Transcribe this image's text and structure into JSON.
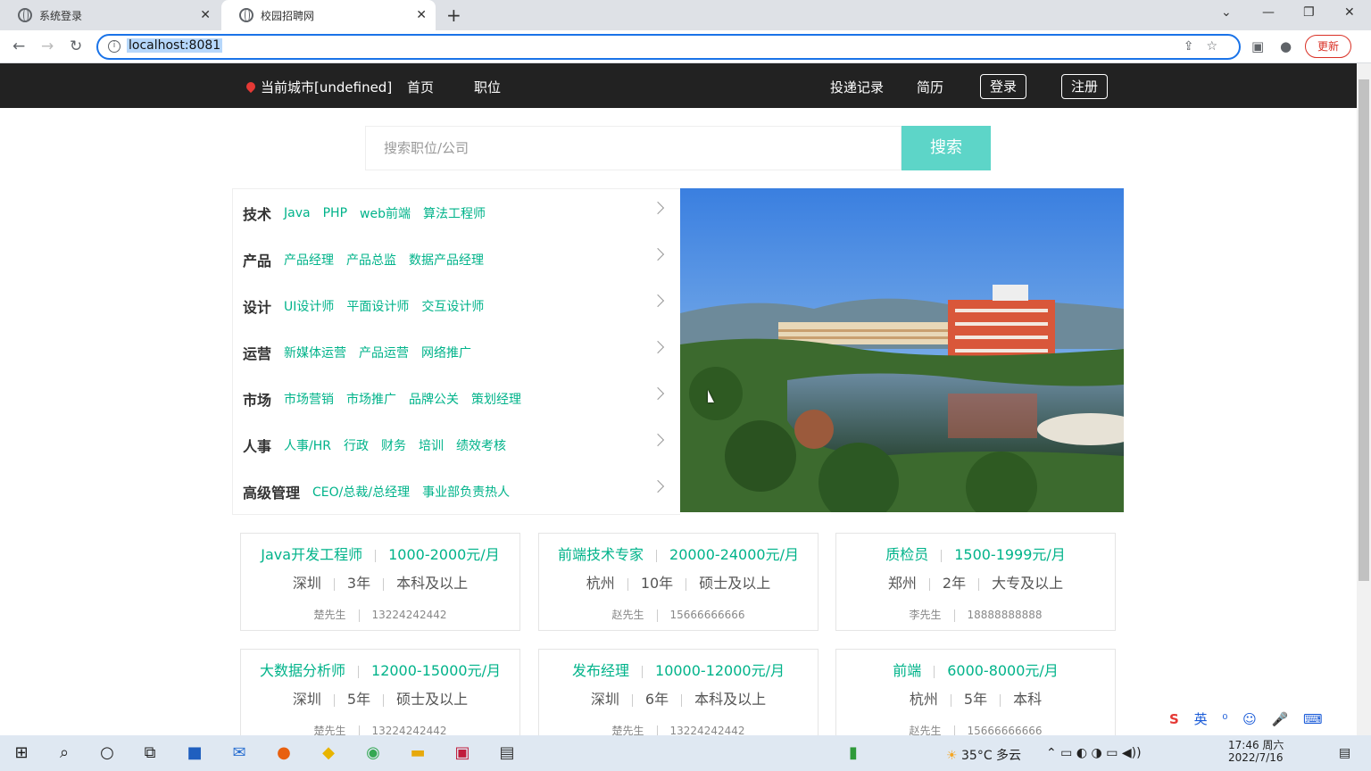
{
  "browser": {
    "tabs": [
      {
        "label": "系统登录"
      },
      {
        "label": "校园招聘网"
      }
    ],
    "url": "localhost:8081",
    "update_label": "更新"
  },
  "nav": {
    "city": "当前城市[undefined]",
    "home": "首页",
    "jobs": "职位",
    "records": "投递记录",
    "resume": "简历",
    "login": "登录",
    "register": "注册"
  },
  "search": {
    "placeholder": "搜索职位/公司",
    "button": "搜索"
  },
  "categories": [
    {
      "name": "技术",
      "links": [
        "Java",
        "PHP",
        "web前端",
        "算法工程师"
      ]
    },
    {
      "name": "产品",
      "links": [
        "产品经理",
        "产品总监",
        "数据产品经理"
      ]
    },
    {
      "name": "设计",
      "links": [
        "UI设计师",
        "平面设计师",
        "交互设计师"
      ]
    },
    {
      "name": "运营",
      "links": [
        "新媒体运营",
        "产品运营",
        "网络推广"
      ]
    },
    {
      "name": "市场",
      "links": [
        "市场营销",
        "市场推广",
        "品牌公关",
        "策划经理"
      ]
    },
    {
      "name": "人事",
      "links": [
        "人事/HR",
        "行政",
        "财务",
        "培训",
        "绩效考核"
      ]
    },
    {
      "name": "高级管理",
      "links": [
        "CEO/总裁/总经理",
        "事业部负责热人"
      ]
    }
  ],
  "jobs": [
    {
      "title": "Java开发工程师",
      "salary": "1000-2000元/月",
      "city": "深圳",
      "exp": "3年",
      "edu": "本科及以上",
      "contact": "楚先生",
      "phone": "13224242442"
    },
    {
      "title": "前端技术专家",
      "salary": "20000-24000元/月",
      "city": "杭州",
      "exp": "10年",
      "edu": "硕士及以上",
      "contact": "赵先生",
      "phone": "15666666666"
    },
    {
      "title": "质检员",
      "salary": "1500-1999元/月",
      "city": "郑州",
      "exp": "2年",
      "edu": "大专及以上",
      "contact": "李先生",
      "phone": "18888888888"
    },
    {
      "title": "大数据分析师",
      "salary": "12000-15000元/月",
      "city": "深圳",
      "exp": "5年",
      "edu": "硕士及以上",
      "contact": "楚先生",
      "phone": "13224242442"
    },
    {
      "title": "发布经理",
      "salary": "10000-12000元/月",
      "city": "深圳",
      "exp": "6年",
      "edu": "本科及以上",
      "contact": "楚先生",
      "phone": "13224242442"
    },
    {
      "title": "前端",
      "salary": "6000-8000元/月",
      "city": "杭州",
      "exp": "5年",
      "edu": "本科",
      "contact": "赵先生",
      "phone": "15666666666"
    }
  ],
  "taskbar": {
    "weather": "35°C 多云",
    "time": "17:46 周六",
    "date": "2022/7/16",
    "ime": "英"
  }
}
